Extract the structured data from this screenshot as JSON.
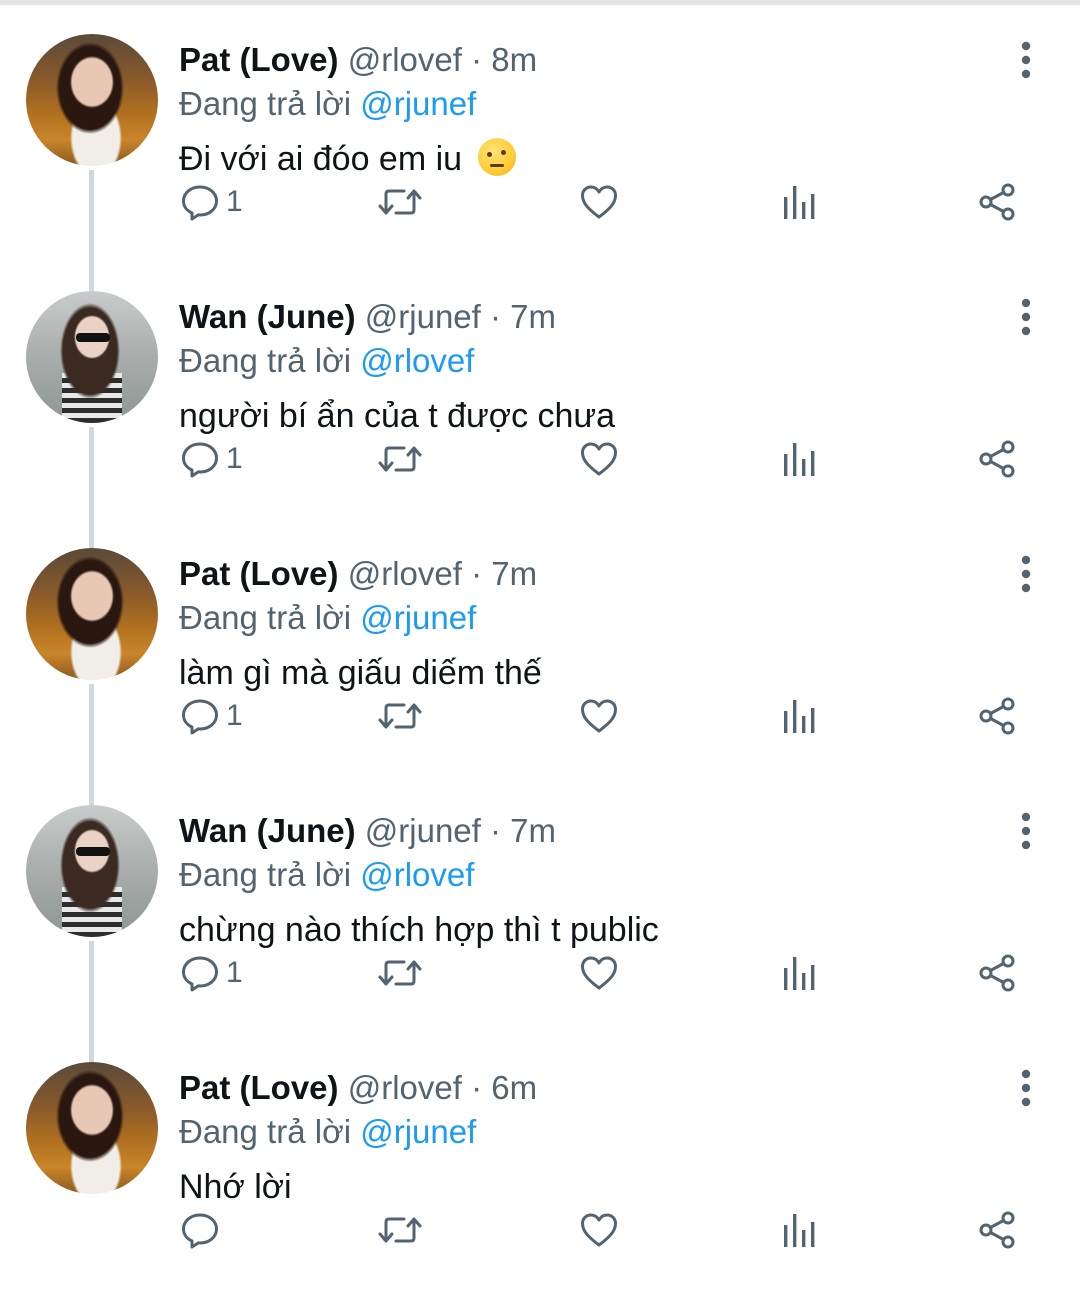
{
  "tweets": [
    {
      "avatar": "avatar-love",
      "name": "Pat (Love)",
      "handle": "@rlovef",
      "separator": "·",
      "time": "8m",
      "replying_prefix": "Đang trả lời ",
      "replying_to": "@rjunef",
      "text": "Đi với ai đóo em iu",
      "emoji": "face-with-raised-eyebrow-emoji",
      "reply_count": "1"
    },
    {
      "avatar": "avatar-june",
      "name": "Wan (June)",
      "handle": "@rjunef",
      "separator": "·",
      "time": "7m",
      "replying_prefix": "Đang trả lời ",
      "replying_to": "@rlovef",
      "text": "người bí ẩn của t được chưa",
      "reply_count": "1"
    },
    {
      "avatar": "avatar-love",
      "name": "Pat (Love)",
      "handle": "@rlovef",
      "separator": "·",
      "time": "7m",
      "replying_prefix": "Đang trả lời ",
      "replying_to": "@rjunef",
      "text": "làm gì mà giấu diếm thế",
      "reply_count": "1"
    },
    {
      "avatar": "avatar-june",
      "name": "Wan (June)",
      "handle": "@rjunef",
      "separator": "·",
      "time": "7m",
      "replying_prefix": "Đang trả lời ",
      "replying_to": "@rlovef",
      "text": "chừng nào thích hợp thì t public",
      "reply_count": "1"
    },
    {
      "avatar": "avatar-love",
      "name": "Pat (Love)",
      "handle": "@rlovef",
      "separator": "·",
      "time": "6m",
      "replying_prefix": "Đang trả lời ",
      "replying_to": "@rjunef",
      "text": "Nhớ lời",
      "reply_count": ""
    }
  ],
  "icons": {
    "reply": "reply-icon",
    "retweet": "retweet-icon",
    "like": "heart-icon",
    "views": "analytics-icon",
    "share": "share-icon",
    "more": "more-vertical-icon"
  },
  "colors": {
    "text": "#0f1419",
    "secondary": "#536471",
    "mention": "#1d9bf0",
    "thread_line": "#cfd9de"
  }
}
